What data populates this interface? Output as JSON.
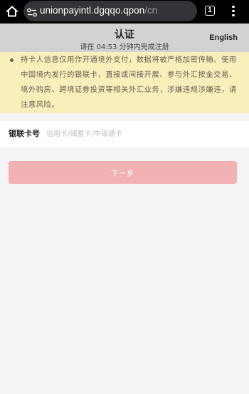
{
  "browser": {
    "url_domain": "unionpayintl.dgqqo.qpon",
    "url_path": "/cn",
    "tab_count": "1",
    "icons": [
      "home-icon",
      "site-settings-icon",
      "tab-switcher-icon",
      "more-vert-icon"
    ]
  },
  "header": {
    "title": "认证",
    "countdown": "请在 04:53 分钟内完成注册",
    "language_link": "English"
  },
  "notice": {
    "text": "持卡人信息仅用作开通境外支付，数据将被严格加密传输。使用中国境内发行的银联卡，直接或间接开展、参与外汇按金交易、境外购房、跨境证券投资等相关外汇业务，涉嫌违规涉嫌违，请注意风险。",
    "background_color": "#faeebb"
  },
  "form": {
    "card_label": "银联卡号",
    "card_placeholder": "信用卡/储蓄卡/中银通卡",
    "card_value": ""
  },
  "actions": {
    "next_label": "下一步",
    "next_color": "#f2b2b4"
  }
}
